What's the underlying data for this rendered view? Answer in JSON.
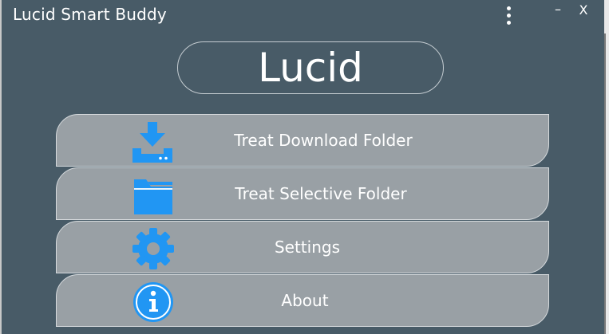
{
  "window": {
    "title": "Lucid Smart Buddy",
    "minimize_label": "–",
    "close_label": "X"
  },
  "brand": {
    "name": "Lucid"
  },
  "menu": {
    "items": [
      {
        "label": "Treat Download Folder",
        "icon": "download-tray-icon"
      },
      {
        "label": "Treat Selective Folder",
        "icon": "folder-icon"
      },
      {
        "label": "Settings",
        "icon": "gear-icon"
      },
      {
        "label": "About",
        "icon": "info-icon"
      }
    ]
  },
  "colors": {
    "background": "#485b67",
    "button": "#99a0a5",
    "icon_blue": "#2196f3",
    "text": "#ffffff"
  }
}
